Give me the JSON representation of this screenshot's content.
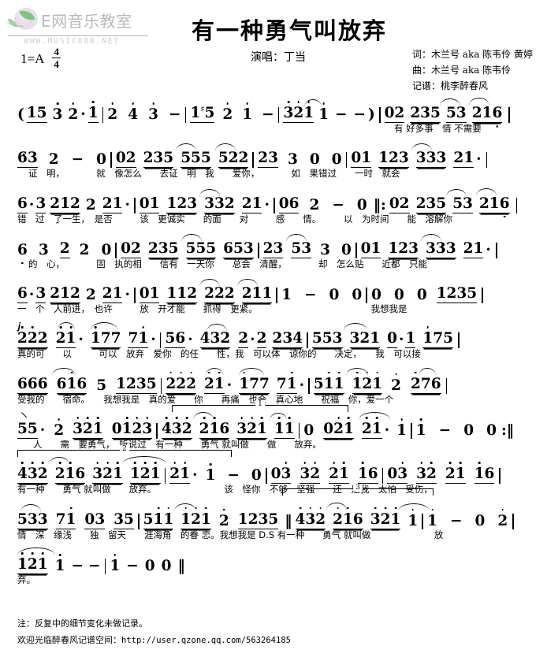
{
  "logo": {
    "brand": "E网音乐教室",
    "url": "WWW.MUSIC888.NET",
    "icon": "leaf-flower-logo"
  },
  "header": {
    "title": "有一种勇气叫放弃",
    "key_label": "1=",
    "key_value": "A",
    "time_numerator": "4",
    "time_denominator": "4",
    "singer": "演唱：丁当",
    "credits": [
      "词：木兰号 aka 陈韦伶 黄婷",
      "曲：木兰号 aka 陈韦伶",
      "记谱：桃李醉春风"
    ]
  },
  "score": {
    "lines": [
      {
        "notes": "( 1 5  3 2 · 1  |  2  4  3  -  |  1 #5  2  1  -  -  |  3 2 1  1  -  - )  |  02  235  53  216  |",
        "lyrics": "有 好多事　情 不需要"
      },
      {
        "notes": "63  2  -  0  |  02  235  555  522  |  23  3  0  0  |  01  123  333  21 ·  |",
        "lyrics": "证　明，　　　　就　像怎么　　去证　明　我　　爱你，　　　　如　果错过　　一时　就会"
      },
      {
        "notes": "6 · 3  212  2  21 ·  |  01  123  332  21 ·  |  06  2  -  0  ‖:  02  235  53  216  |",
        "lyrics": "错　过　了一生，　是否　　　该　更诚实　　的面　　对　　　感　　情。　　　以　为时间　　能　溶解你"
      },
      {
        "notes": "6  3  2  2  0  |  02  235  555  653  |  23  53  3  0  |  01  123  333  21 ·  |",
        "lyrics": "的　心，　　　　固　执的相　　信有　一天你　　总会　清醒，　　　　却　怎么贴　　近都　只能"
      },
      {
        "notes": "6 · 3  212  2  21 ·  |  01  112  222  211  |  1  -  0  0  |  0  0  0  1235  |",
        "lyrics": "一　个　人前进，　也许　　　放　开才能　　抓得　更紧。　　　　　　　　　　　　　我想我是"
      },
      {
        "notes": "222  21 ·  177  71 ·  |  56 ·  432  2 · 2  234  |  553  321  0 · 1  175  |",
        "lyrics": "真的可　　以　　　可以　放弃　爱你　的任　　性，我　可以体　谅你的　　决定，　　我　可以接"
      },
      {
        "notes": "666  616  5  1235  |  222  21 ·  177  71 ·  |  511  121  2  276  |",
        "lyrics": "受我的　　宿命。　　我想我是　真的爱　　你　　再痛　也会　真心地　　祝福　你，爱一个"
      },
      {
        "notes": "55 ·  2  321  0123  |  432  216  321  11  |  0  021  21 ·  1  |  1  -  0  0  :‖",
        "lyrics": "人　　需　要勇气，　听说过　有一种　　勇气 就叫做　　做　　放弃。"
      },
      {
        "notes": "432  216  321  121  |  21 ·  1  -  0  |  03  32  21  16  |  03  32  21  16  |",
        "lyrics": "有一种　　勇气 就叫做　　放弃。　　　　　　　　该　怪你　不够　坚强　　还　是我　太怕　受伤，"
      },
      {
        "notes": "533  71  03  35  |  511  121  2  1235  ‖  432  216  321  1  |  1  -  0  2  |",
        "lyrics": "情　深　缘浅　　独　留天　　涯海角　的眷 恋。我想我是 D.S 有一种　　勇气 就叫做　　　　　　　放"
      },
      {
        "notes": "121  1  -  -  |  1  -  0  0  ‖",
        "lyrics": "弃。"
      }
    ],
    "brackets": [
      {
        "label": "1"
      },
      {
        "label": "2"
      },
      {
        "label": "3"
      }
    ],
    "symbols": {
      "segno": "𝄋",
      "ds": "D.S",
      "repeat_start": "‖:",
      "repeat_end": ":‖",
      "final_barline": "‖"
    }
  },
  "footnotes": {
    "note": "注：反复中的细节变化未做记录。",
    "space_label": "欢迎光临醉春风记谱空间：",
    "space_url": "http://user.qzone.qq.com/563264185"
  }
}
